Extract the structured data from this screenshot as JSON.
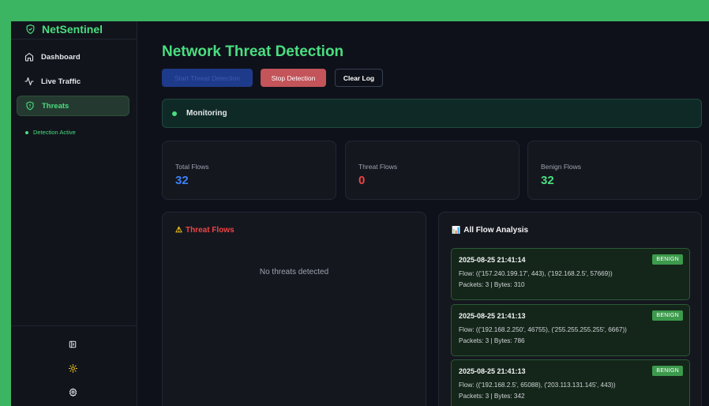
{
  "sidebar": {
    "brand": "NetSentinel",
    "items": [
      {
        "label": "Dashboard",
        "icon": "home-icon"
      },
      {
        "label": "Live Traffic",
        "icon": "activity-icon"
      },
      {
        "label": "Threats",
        "icon": "shield-icon",
        "active": true
      }
    ],
    "status": "Detection Active",
    "bottom_icons": [
      "sidebar-toggle-icon",
      "sun-icon",
      "settings-icon"
    ]
  },
  "main": {
    "title": "Network Threat Detection",
    "buttons": {
      "start": "Start Threat Detection",
      "stop": "Stop Detection",
      "clear": "Clear Log"
    },
    "monitor_status": "Monitoring",
    "stats": [
      {
        "label": "Total Flows",
        "value": "32",
        "color": "#3b82f6"
      },
      {
        "label": "Threat Flows",
        "value": "0",
        "color": "#ef4444"
      },
      {
        "label": "Benign Flows",
        "value": "32",
        "color": "#4ade80"
      }
    ],
    "threat_panel": {
      "icon": "⚠",
      "title": "Threat Flows",
      "empty": "No threats detected"
    },
    "analysis_panel": {
      "icon": "📊",
      "title": "All Flow Analysis",
      "flows": [
        {
          "timestamp": "2025-08-25 21:41:14",
          "badge": "BENIGN",
          "flow": "Flow: (('157.240.199.17', 443), ('192.168.2.5', 57669))",
          "meta": "Packets: 3 | Bytes: 310"
        },
        {
          "timestamp": "2025-08-25 21:41:13",
          "badge": "BENIGN",
          "flow": "Flow: (('192.168.2.250', 46755), ('255.255.255.255', 6667))",
          "meta": "Packets: 3 | Bytes: 786"
        },
        {
          "timestamp": "2025-08-25 21:41:13",
          "badge": "BENIGN",
          "flow": "Flow: (('192.168.2.5', 65088), ('203.113.131.145', 443))",
          "meta": "Packets: 3 | Bytes: 342"
        }
      ]
    }
  }
}
